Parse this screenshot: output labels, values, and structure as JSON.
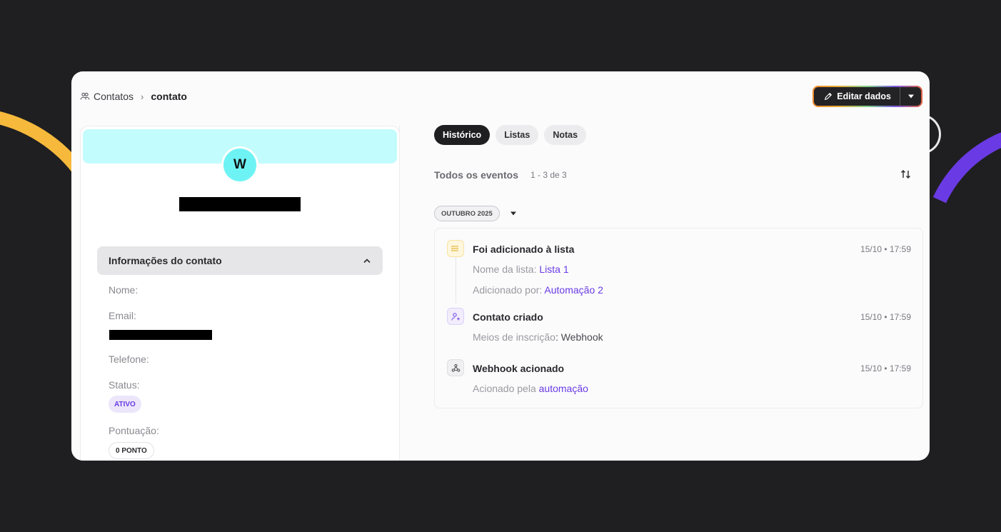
{
  "breadcrumb": {
    "parent": "Contatos",
    "current": "contato"
  },
  "header": {
    "edit_label": "Editar dados"
  },
  "profile": {
    "avatar_letter": "W"
  },
  "contact_info": {
    "section_title": "Informações do contato",
    "fields": {
      "name_label": "Nome:",
      "email_label": "Email:",
      "phone_label": "Telefone:",
      "status_label": "Status:",
      "status_value": "ATIVO",
      "score_label": "Pontuação:",
      "score_value": "0 PONTO"
    }
  },
  "tabs": [
    {
      "label": "Histórico",
      "active": true
    },
    {
      "label": "Listas",
      "active": false
    },
    {
      "label": "Notas",
      "active": false
    }
  ],
  "events": {
    "title": "Todos os eventos",
    "count": "1 - 3 de 3",
    "month": "OUTUBRO 2025",
    "items": [
      {
        "title": "Foi adicionado à lista",
        "time": "15/10 • 17:59",
        "line1_label": "Nome da lista:",
        "line1_value": "Lista 1",
        "line2_label": "Adicionado por:",
        "line2_value": "Automação 2"
      },
      {
        "title": "Contato criado",
        "time": "15/10 • 17:59",
        "line1_label": "Meios de inscrição",
        "line1_colon": ":",
        "line1_value": "Webhook"
      },
      {
        "title": "Webhook acionado",
        "time": "15/10 • 17:59",
        "line1_label": "Acionado pela",
        "line1_value": "automação"
      }
    ]
  },
  "colors": {
    "accent": "#6a3be4",
    "banner": "#c2fcfc",
    "avatar": "#6ef3f5",
    "background": "#1f1f21",
    "arc_left": "#f6b93b",
    "arc_right": "#6a3be4"
  }
}
